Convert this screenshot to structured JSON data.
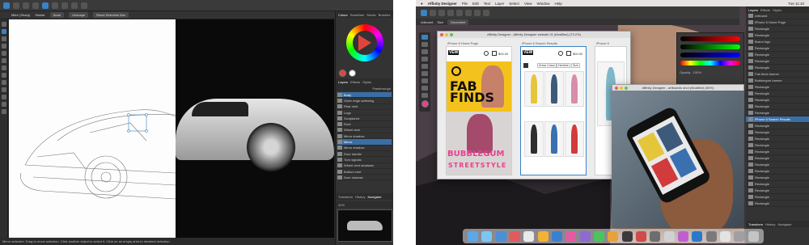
{
  "left_screenshot": {
    "context_bar": {
      "field_1": "Mitre (Sharp)",
      "field_2": "Similar",
      "button_1": "None",
      "button_2": "Unshape",
      "button_3": "Reset Selection Box"
    },
    "studio_tabs": [
      "Colour",
      "Swatches",
      "Stroke",
      "Brushes"
    ],
    "layers_tabs": [
      "Layers",
      "Effects",
      "Styles"
    ],
    "layers_header": "Passthrough",
    "layers": [
      "Body",
      "Outer edge softening",
      "Rear vent",
      "Logo",
      "Sculptured",
      "Roof",
      "Wheel arch",
      "Mirror shadow",
      "Mirror",
      "Mirror shadow",
      "Door handle",
      "Turn signals",
      "Wheel vent shadows",
      "Bottom vent",
      "Door shadow"
    ],
    "bottom_tabs": [
      "Transform",
      "History",
      "Navigator"
    ],
    "zoom": "42%",
    "status": "Mirror selected. Drag to move selection. Click another object to select it. Click on an empty area to deselect selection."
  },
  "right_screenshot": {
    "menubar": {
      "app": "Affinity Designer",
      "items": [
        "File",
        "Edit",
        "Text",
        "Layer",
        "Select",
        "View",
        "Window",
        "Help"
      ],
      "clock": "Tue 11:10"
    },
    "context_bar": {
      "artboard_label": "Artboard",
      "size_label": "Size",
      "size_value": "Document"
    },
    "window_title": "Affinity Designer - Affinity Designer website 01 (Modified) (73.2%)",
    "artboards": [
      {
        "label": "iPhone 6 Home Page",
        "logo": "VEW",
        "price": "$00.00",
        "hero_line_1": "FAB",
        "hero_line_2": "FINDS",
        "banner_1": "BUBBLEGUM",
        "banner_2": "STREETSTYLE"
      },
      {
        "label": "iPhone 6 Search Results",
        "logo": "VEW",
        "price": "$00.00",
        "filter_1": "Dress Colour",
        "filter_2": "Hemline",
        "filter_3": "Size"
      },
      {
        "label": "iPhone 6"
      }
    ],
    "photo_window_title": "Affinity Designer - artboards shot (Modified) (50%)",
    "layers_tabs": [
      "Layers",
      "Effects",
      "Styles"
    ],
    "layers": [
      "Artboard",
      "iPhone 6 Home Page",
      "Rectangle",
      "Rectangle",
      "Brand logo",
      "Rectangle",
      "Rectangle",
      "Rectangle",
      "Rectangle",
      "Fab finds banner",
      "Bubblegum banner",
      "Rectangle",
      "Rectangle",
      "Rectangle",
      "Rectangle",
      "Rectangle",
      "iPhone 6 Search Results",
      "Rectangle",
      "Rectangle",
      "Rectangle",
      "Rectangle",
      "Rectangle",
      "Rectangle",
      "Rectangle",
      "Rectangle",
      "Rectangle",
      "Rectangle",
      "Rectangle",
      "Rectangle",
      "Rectangle"
    ],
    "bottom_tabs": [
      "Transform",
      "History",
      "Navigator"
    ],
    "opacity_label": "Opacity",
    "opacity_value": "100%",
    "dock_icon_colors": [
      "#5ba7e8",
      "#7ac6f7",
      "#4a90d9",
      "#e05b5b",
      "#e9e9e9",
      "#f2b233",
      "#3a80d1",
      "#e25da0",
      "#8e6ad1",
      "#4fc35b",
      "#e8a23a",
      "#3a3a3a",
      "#d04a4a",
      "#6d6d6d",
      "#d1d1d1",
      "#c05ecf",
      "#2a78c6",
      "#7a7a7a",
      "#e3e3e3",
      "#a0a0a0",
      "#c4c4c4"
    ]
  },
  "colors": {
    "accent_blue": "#3b82c4",
    "selection": "#3b6ea5",
    "pink": "#e8418f",
    "yellow": "#f4c21d"
  }
}
